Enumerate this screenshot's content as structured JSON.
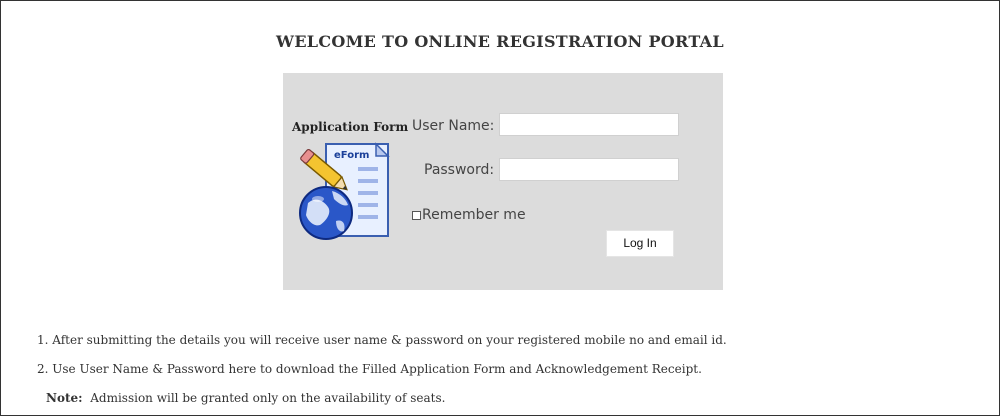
{
  "page": {
    "title": "WELCOME TO ONLINE REGISTRATION PORTAL"
  },
  "login": {
    "app_label": "Application Form",
    "eform_label": "eForm",
    "username_label": "User Name:",
    "username_value": "",
    "password_label": "Password:",
    "password_value": "",
    "remember_label": "Remember me",
    "remember_checked": false,
    "login_button": "Log In",
    "panel_color": "#dcdcdc"
  },
  "notes": {
    "item1": "1. After submitting the details you will receive user name & password on your registered mobile no and email id.",
    "item2": "2. Use User Name & Password here to download the Filled Application Form and Acknowledgement Receipt.",
    "note_label": "Note:",
    "note_text": "Admission will be granted only on the availability of seats."
  }
}
